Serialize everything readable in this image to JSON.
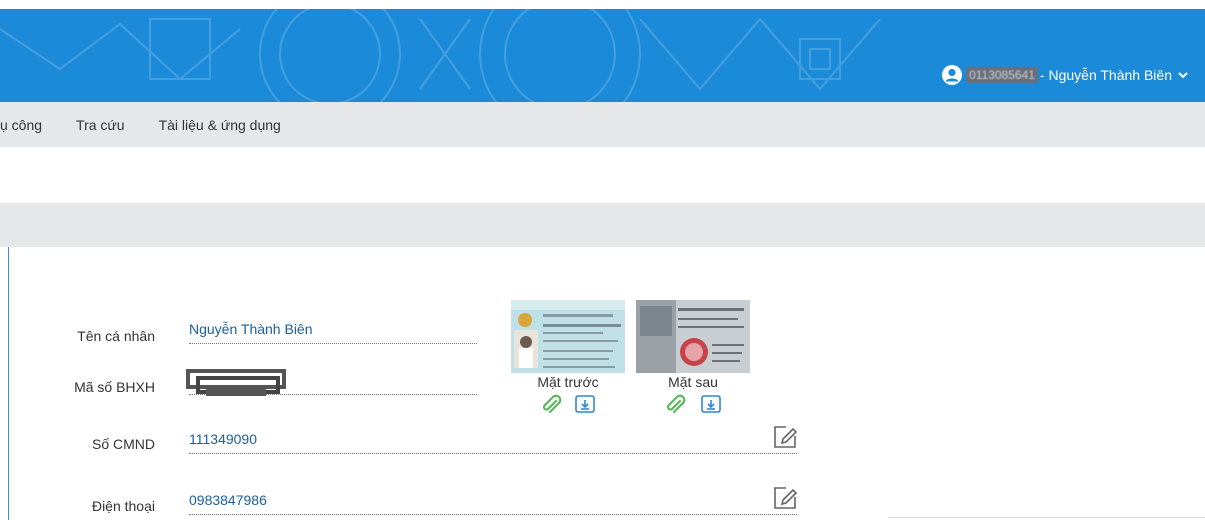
{
  "header": {
    "user_id": "0113085641",
    "user_name": "- Nguyễn Thành Biên",
    "icons": {
      "user": "user-circle-icon",
      "menu": "chevron-down-icon"
    }
  },
  "nav": {
    "items": [
      {
        "label": "ụ công"
      },
      {
        "label": "Tra cứu"
      },
      {
        "label": "Tài liệu & ứng dụng"
      }
    ]
  },
  "form": {
    "name_label": "Tên cá nhân",
    "name_value": "Nguyễn Thành Biên",
    "bhxh_label": "Mã số BHXH",
    "cmnd_label": "Số CMND",
    "cmnd_value": "111349090",
    "phone_label": "Điện thoại",
    "phone_value": "0983847986"
  },
  "id_card": {
    "front_caption": "Mặt trước",
    "back_caption": "Mặt sau"
  },
  "colors": {
    "header_blue": "#1b8ad9",
    "nav_gray": "#e6e7e9",
    "value_blue": "#1a5f9e",
    "icon_green": "#5cb85c",
    "icon_blue": "#2f86d4"
  }
}
